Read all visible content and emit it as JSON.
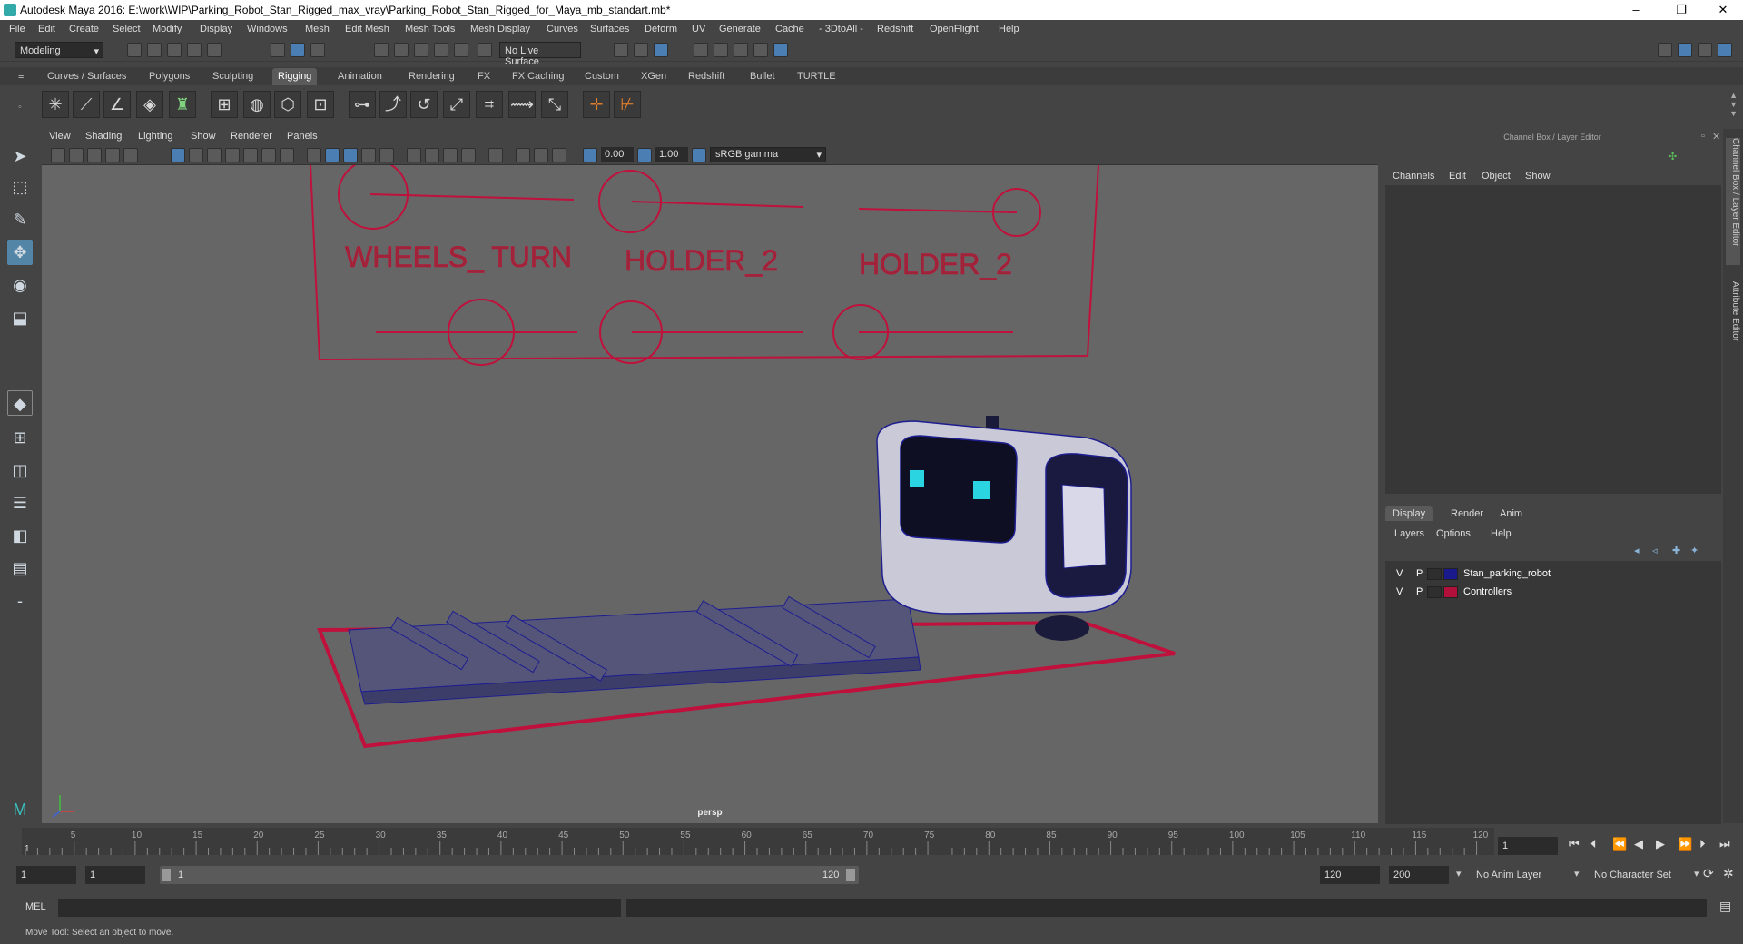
{
  "window": {
    "title": "Autodesk Maya 2016: E:\\work\\WIP\\Parking_Robot_Stan_Rigged_max_vray\\Parking_Robot_Stan_Rigged_for_Maya_mb_standart.mb*",
    "minimize": "–",
    "maximize": "❐",
    "close": "✕"
  },
  "menubar": [
    "File",
    "Edit",
    "Create",
    "Select",
    "Modify",
    "Display",
    "Windows",
    "Mesh",
    "Edit Mesh",
    "Mesh Tools",
    "Mesh Display",
    "Curves",
    "Surfaces",
    "Deform",
    "UV",
    "Generate",
    "Cache",
    "- 3DtoAll -",
    "Redshift",
    "OpenFlight",
    "Help"
  ],
  "statusline": {
    "mode": "Modeling",
    "live_surface": "No Live Surface"
  },
  "shelf_tabs": [
    "Curves / Surfaces",
    "Polygons",
    "Sculpting",
    "Rigging",
    "Animation",
    "Rendering",
    "FX",
    "FX Caching",
    "Custom",
    "XGen",
    "Redshift",
    "Bullet",
    "TURTLE"
  ],
  "active_shelf_tab": "Rigging",
  "viewport": {
    "menu": [
      "View",
      "Shading",
      "Lighting",
      "Show",
      "Renderer",
      "Panels"
    ],
    "exposure": "0.00",
    "gamma": "1.00",
    "color_space": "sRGB gamma",
    "camera_label": "persp",
    "scene_labels": [
      "WHEELS_ TURN",
      "HOLDER_2",
      "HOLDER_2"
    ]
  },
  "channel_box": {
    "header": "Channel Box / Layer Editor",
    "menu": [
      "Channels",
      "Edit",
      "Object",
      "Show"
    ]
  },
  "layer_editor": {
    "tabs": [
      "Display",
      "Render",
      "Anim"
    ],
    "active_tab": "Display",
    "menu": [
      "Layers",
      "Options",
      "Help"
    ],
    "layers": [
      {
        "v": "V",
        "p": "P",
        "name": "Stan_parking_robot",
        "color": "#1a1a8c"
      },
      {
        "v": "V",
        "p": "P",
        "name": "Controllers",
        "color": "#b0103a"
      }
    ]
  },
  "side_tabs": [
    "Channel Box / Layer Editor",
    "Attribute Editor"
  ],
  "timeline": {
    "ticks": [
      "5",
      "10",
      "15",
      "20",
      "25",
      "30",
      "35",
      "40",
      "45",
      "50",
      "55",
      "60",
      "65",
      "70",
      "75",
      "80",
      "85",
      "90",
      "95",
      "100",
      "105",
      "110",
      "115",
      "120"
    ],
    "current_frame_marker": "1",
    "current_frame": "1"
  },
  "range": {
    "start": "1",
    "playback_start": "1",
    "slider_start": "1",
    "slider_end": "120",
    "playback_end": "120",
    "end": "200",
    "anim_layer": "No Anim Layer",
    "character_set": "No Character Set"
  },
  "mel": {
    "label": "MEL"
  },
  "help_line": "Move Tool: Select an object to move.",
  "colors": {
    "accent": "#5285a6",
    "wire_blue": "#1a1a8c",
    "controller_red": "#c0103c"
  }
}
